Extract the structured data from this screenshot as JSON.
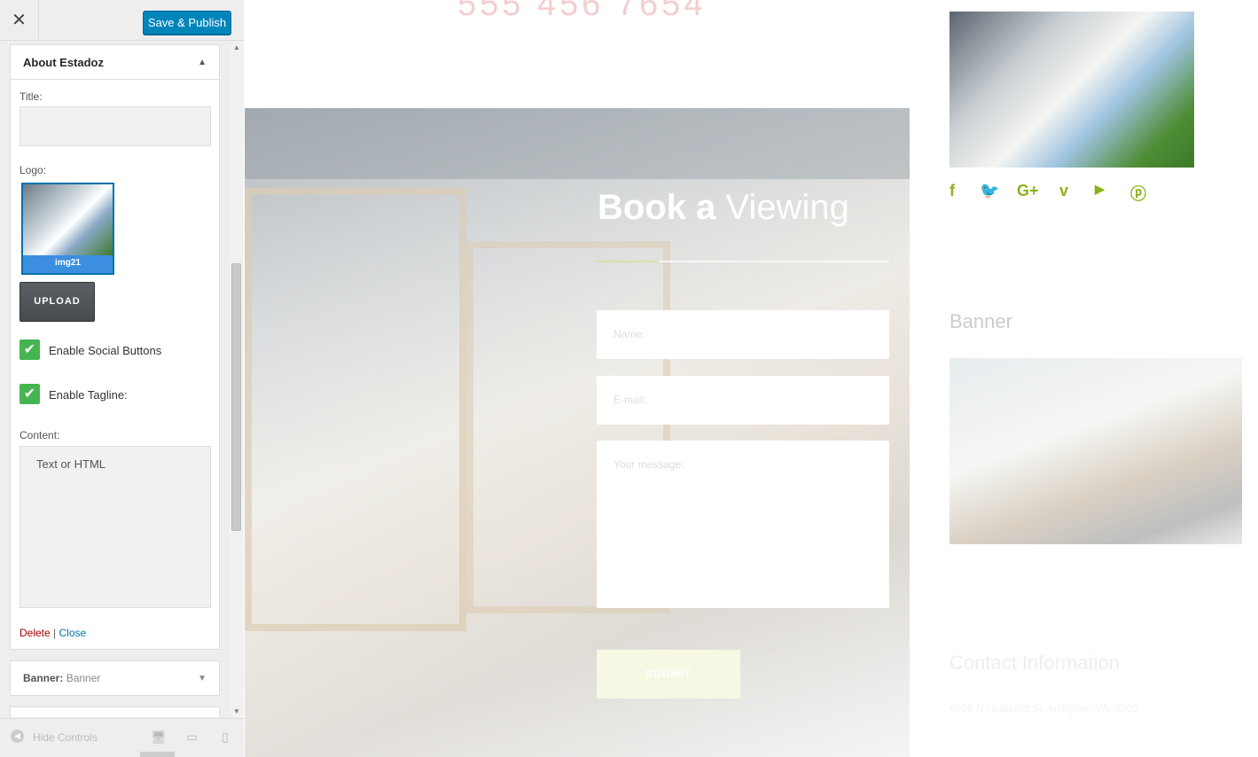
{
  "topbar": {
    "close_label": "✕",
    "save_label": "Save & Publish"
  },
  "panel": {
    "title": "About Estadoz",
    "title_label": "Title:",
    "title_value": "",
    "logo_label": "Logo:",
    "logo_caption": "img21",
    "upload_label": "UPLOAD",
    "social_label": "Enable Social Buttons",
    "social_checked": true,
    "tagline_label": "Enable Tagline:",
    "tagline_checked": true,
    "content_label": "Content:",
    "content_placeholder": "Text or HTML",
    "delete_label": "Delete",
    "separator": "|",
    "close_label": "Close"
  },
  "banner_section": {
    "label": "Banner:",
    "value": "Banner"
  },
  "footer": {
    "hide_label": "Hide Controls"
  },
  "preview": {
    "phone_partial": "555 456 7654",
    "book_bold": "Book a",
    "book_light": "Viewing",
    "name_placeholder": "Name:",
    "email_placeholder": "E-mail:",
    "message_placeholder": "Your message:",
    "submit_label": "SUBMIT",
    "banner_title": "Banner",
    "contact_title": "Contact Information",
    "address": "4055 N Highland St, Arlington, VA, 3205"
  },
  "social_icons": [
    "facebook-icon",
    "twitter-icon",
    "google-plus-icon",
    "vimeo-icon",
    "youtube-icon",
    "pinterest-icon"
  ],
  "colors": {
    "accent": "#0085ba",
    "checkbox": "#46b450",
    "social": "#8cb21b",
    "delete": "#aa0000"
  }
}
